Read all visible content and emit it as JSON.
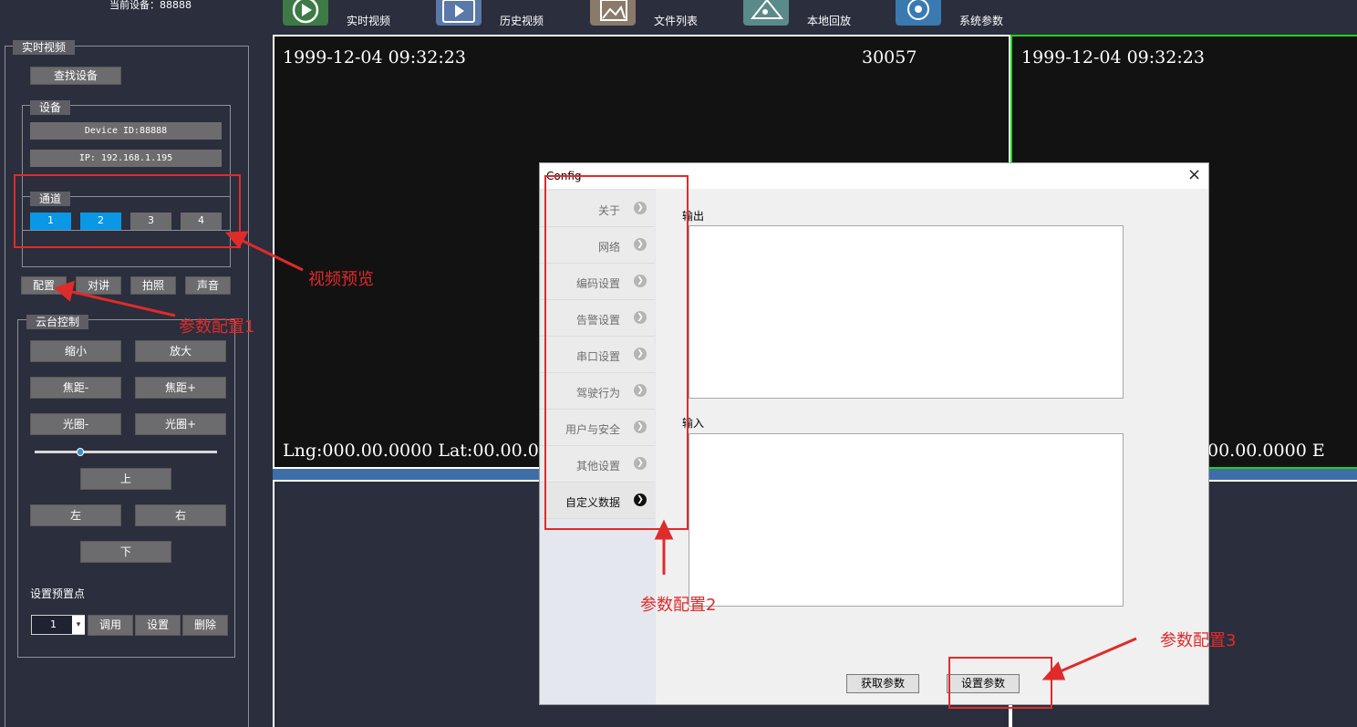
{
  "status": {
    "text": "当前设备：88888"
  },
  "nav": [
    {
      "label": "实时视频",
      "icon": "play-icon"
    },
    {
      "label": "历史视频",
      "icon": "video-history-icon"
    },
    {
      "label": "文件列表",
      "icon": "image-list-icon"
    },
    {
      "label": "本地回放",
      "icon": "local-playback-icon"
    },
    {
      "label": "系统参数",
      "icon": "settings-gear-icon"
    }
  ],
  "sidebar": {
    "group_title": "实时视频",
    "find_device": "查找设备",
    "device": {
      "title": "设备",
      "id": "Device ID:88888",
      "ip": "IP: 192.168.1.195"
    },
    "channel": {
      "title": "通道",
      "items": [
        "1",
        "2",
        "3",
        "4"
      ],
      "active": [
        true,
        true,
        false,
        false
      ],
      "active_color": "#0a97e6"
    },
    "actions": [
      "配置",
      "对讲",
      "拍照",
      "声音"
    ],
    "ptz": {
      "title": "云台控制",
      "zoom_out": "缩小",
      "zoom_in": "放大",
      "focus_minus": "焦距-",
      "focus_plus": "焦距+",
      "iris_minus": "光圈-",
      "iris_plus": "光圈+",
      "up": "上",
      "left": "左",
      "right": "右",
      "down": "下",
      "slider_level": 0.25
    },
    "preset": {
      "label": "设置预置点",
      "selected": "1",
      "call": "调用",
      "set": "设置",
      "delete": "删除"
    }
  },
  "video": {
    "tile1": {
      "datetime": "1999-12-04 09:32:23",
      "counter": "30057",
      "gps": "Lng:000.00.0000 Lat:00.00.00"
    },
    "tile2": {
      "datetime": "1999-12-04 09:32:23",
      "gps": "00.00.0000 E"
    }
  },
  "dialog": {
    "title": "Config",
    "close": "×",
    "menu": [
      "关于",
      "网络",
      "编码设置",
      "告警设置",
      "串口设置",
      "驾驶行为",
      "用户与安全",
      "其他设置",
      "自定义数据"
    ],
    "active_index": 8,
    "output_label": "输出",
    "input_label": "输入",
    "get_params": "获取参数",
    "set_params": "设置参数"
  },
  "annotations": {
    "video_preview": "视频预览",
    "param_config_1": "参数配置1",
    "param_config_2": "参数配置2",
    "param_config_3": "参数配置3",
    "color": "#e02b2b"
  }
}
